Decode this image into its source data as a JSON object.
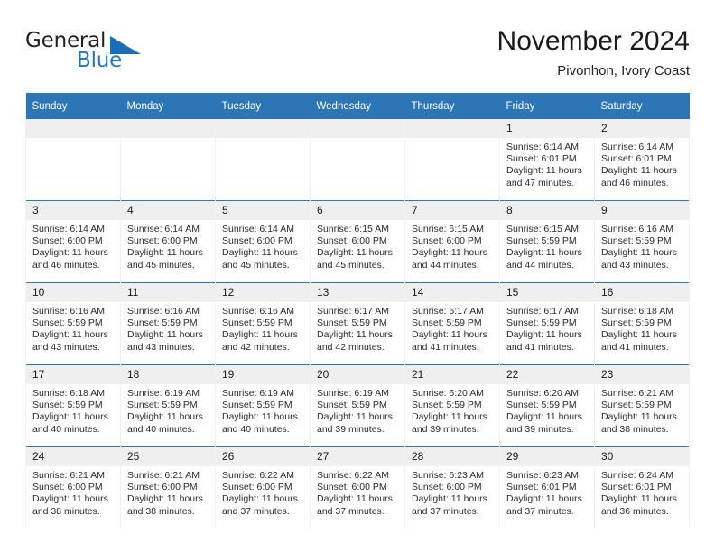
{
  "brand": {
    "name_part1": "General",
    "name_part2": "Blue",
    "triangle_icon": "triangle-logo-icon",
    "colors": {
      "blue": "#1d78c1",
      "dark": "#231f20",
      "header_blue": "#2e75b6",
      "daynum_gray": "#efefef"
    }
  },
  "header": {
    "month_title": "November 2024",
    "location": "Pivonhon, Ivory Coast"
  },
  "calendar": {
    "weekday_headers": [
      "Sunday",
      "Monday",
      "Tuesday",
      "Wednesday",
      "Thursday",
      "Friday",
      "Saturday"
    ],
    "weeks": [
      [
        {
          "day": "",
          "empty": true
        },
        {
          "day": "",
          "empty": true
        },
        {
          "day": "",
          "empty": true
        },
        {
          "day": "",
          "empty": true
        },
        {
          "day": "",
          "empty": true
        },
        {
          "day": "1",
          "sunrise": "Sunrise: 6:14 AM",
          "sunset": "Sunset: 6:01 PM",
          "daylight": "Daylight: 11 hours and 47 minutes."
        },
        {
          "day": "2",
          "sunrise": "Sunrise: 6:14 AM",
          "sunset": "Sunset: 6:01 PM",
          "daylight": "Daylight: 11 hours and 46 minutes."
        }
      ],
      [
        {
          "day": "3",
          "sunrise": "Sunrise: 6:14 AM",
          "sunset": "Sunset: 6:00 PM",
          "daylight": "Daylight: 11 hours and 46 minutes."
        },
        {
          "day": "4",
          "sunrise": "Sunrise: 6:14 AM",
          "sunset": "Sunset: 6:00 PM",
          "daylight": "Daylight: 11 hours and 45 minutes."
        },
        {
          "day": "5",
          "sunrise": "Sunrise: 6:14 AM",
          "sunset": "Sunset: 6:00 PM",
          "daylight": "Daylight: 11 hours and 45 minutes."
        },
        {
          "day": "6",
          "sunrise": "Sunrise: 6:15 AM",
          "sunset": "Sunset: 6:00 PM",
          "daylight": "Daylight: 11 hours and 45 minutes."
        },
        {
          "day": "7",
          "sunrise": "Sunrise: 6:15 AM",
          "sunset": "Sunset: 6:00 PM",
          "daylight": "Daylight: 11 hours and 44 minutes."
        },
        {
          "day": "8",
          "sunrise": "Sunrise: 6:15 AM",
          "sunset": "Sunset: 5:59 PM",
          "daylight": "Daylight: 11 hours and 44 minutes."
        },
        {
          "day": "9",
          "sunrise": "Sunrise: 6:16 AM",
          "sunset": "Sunset: 5:59 PM",
          "daylight": "Daylight: 11 hours and 43 minutes."
        }
      ],
      [
        {
          "day": "10",
          "sunrise": "Sunrise: 6:16 AM",
          "sunset": "Sunset: 5:59 PM",
          "daylight": "Daylight: 11 hours and 43 minutes."
        },
        {
          "day": "11",
          "sunrise": "Sunrise: 6:16 AM",
          "sunset": "Sunset: 5:59 PM",
          "daylight": "Daylight: 11 hours and 43 minutes."
        },
        {
          "day": "12",
          "sunrise": "Sunrise: 6:16 AM",
          "sunset": "Sunset: 5:59 PM",
          "daylight": "Daylight: 11 hours and 42 minutes."
        },
        {
          "day": "13",
          "sunrise": "Sunrise: 6:17 AM",
          "sunset": "Sunset: 5:59 PM",
          "daylight": "Daylight: 11 hours and 42 minutes."
        },
        {
          "day": "14",
          "sunrise": "Sunrise: 6:17 AM",
          "sunset": "Sunset: 5:59 PM",
          "daylight": "Daylight: 11 hours and 41 minutes."
        },
        {
          "day": "15",
          "sunrise": "Sunrise: 6:17 AM",
          "sunset": "Sunset: 5:59 PM",
          "daylight": "Daylight: 11 hours and 41 minutes."
        },
        {
          "day": "16",
          "sunrise": "Sunrise: 6:18 AM",
          "sunset": "Sunset: 5:59 PM",
          "daylight": "Daylight: 11 hours and 41 minutes."
        }
      ],
      [
        {
          "day": "17",
          "sunrise": "Sunrise: 6:18 AM",
          "sunset": "Sunset: 5:59 PM",
          "daylight": "Daylight: 11 hours and 40 minutes."
        },
        {
          "day": "18",
          "sunrise": "Sunrise: 6:19 AM",
          "sunset": "Sunset: 5:59 PM",
          "daylight": "Daylight: 11 hours and 40 minutes."
        },
        {
          "day": "19",
          "sunrise": "Sunrise: 6:19 AM",
          "sunset": "Sunset: 5:59 PM",
          "daylight": "Daylight: 11 hours and 40 minutes."
        },
        {
          "day": "20",
          "sunrise": "Sunrise: 6:19 AM",
          "sunset": "Sunset: 5:59 PM",
          "daylight": "Daylight: 11 hours and 39 minutes."
        },
        {
          "day": "21",
          "sunrise": "Sunrise: 6:20 AM",
          "sunset": "Sunset: 5:59 PM",
          "daylight": "Daylight: 11 hours and 39 minutes."
        },
        {
          "day": "22",
          "sunrise": "Sunrise: 6:20 AM",
          "sunset": "Sunset: 5:59 PM",
          "daylight": "Daylight: 11 hours and 39 minutes."
        },
        {
          "day": "23",
          "sunrise": "Sunrise: 6:21 AM",
          "sunset": "Sunset: 5:59 PM",
          "daylight": "Daylight: 11 hours and 38 minutes."
        }
      ],
      [
        {
          "day": "24",
          "sunrise": "Sunrise: 6:21 AM",
          "sunset": "Sunset: 6:00 PM",
          "daylight": "Daylight: 11 hours and 38 minutes."
        },
        {
          "day": "25",
          "sunrise": "Sunrise: 6:21 AM",
          "sunset": "Sunset: 6:00 PM",
          "daylight": "Daylight: 11 hours and 38 minutes."
        },
        {
          "day": "26",
          "sunrise": "Sunrise: 6:22 AM",
          "sunset": "Sunset: 6:00 PM",
          "daylight": "Daylight: 11 hours and 37 minutes."
        },
        {
          "day": "27",
          "sunrise": "Sunrise: 6:22 AM",
          "sunset": "Sunset: 6:00 PM",
          "daylight": "Daylight: 11 hours and 37 minutes."
        },
        {
          "day": "28",
          "sunrise": "Sunrise: 6:23 AM",
          "sunset": "Sunset: 6:00 PM",
          "daylight": "Daylight: 11 hours and 37 minutes."
        },
        {
          "day": "29",
          "sunrise": "Sunrise: 6:23 AM",
          "sunset": "Sunset: 6:01 PM",
          "daylight": "Daylight: 11 hours and 37 minutes."
        },
        {
          "day": "30",
          "sunrise": "Sunrise: 6:24 AM",
          "sunset": "Sunset: 6:01 PM",
          "daylight": "Daylight: 11 hours and 36 minutes."
        }
      ]
    ]
  }
}
